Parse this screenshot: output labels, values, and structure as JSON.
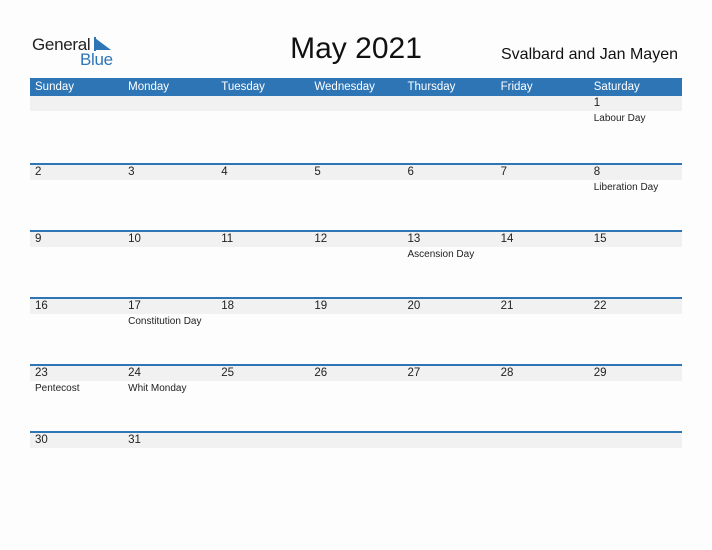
{
  "logo": {
    "general": "General",
    "blue": "Blue"
  },
  "title": "May 2021",
  "region": "Svalbard and Jan Mayen",
  "colors": {
    "accent": "#2e75b6",
    "strip": "#f1f1f1"
  },
  "weekdays": [
    "Sunday",
    "Monday",
    "Tuesday",
    "Wednesday",
    "Thursday",
    "Friday",
    "Saturday"
  ],
  "weeks": [
    [
      {
        "day": "",
        "holiday": ""
      },
      {
        "day": "",
        "holiday": ""
      },
      {
        "day": "",
        "holiday": ""
      },
      {
        "day": "",
        "holiday": ""
      },
      {
        "day": "",
        "holiday": ""
      },
      {
        "day": "",
        "holiday": ""
      },
      {
        "day": "1",
        "holiday": "Labour Day"
      }
    ],
    [
      {
        "day": "2",
        "holiday": ""
      },
      {
        "day": "3",
        "holiday": ""
      },
      {
        "day": "4",
        "holiday": ""
      },
      {
        "day": "5",
        "holiday": ""
      },
      {
        "day": "6",
        "holiday": ""
      },
      {
        "day": "7",
        "holiday": ""
      },
      {
        "day": "8",
        "holiday": "Liberation Day"
      }
    ],
    [
      {
        "day": "9",
        "holiday": ""
      },
      {
        "day": "10",
        "holiday": ""
      },
      {
        "day": "11",
        "holiday": ""
      },
      {
        "day": "12",
        "holiday": ""
      },
      {
        "day": "13",
        "holiday": "Ascension Day"
      },
      {
        "day": "14",
        "holiday": ""
      },
      {
        "day": "15",
        "holiday": ""
      }
    ],
    [
      {
        "day": "16",
        "holiday": ""
      },
      {
        "day": "17",
        "holiday": "Constitution Day"
      },
      {
        "day": "18",
        "holiday": ""
      },
      {
        "day": "19",
        "holiday": ""
      },
      {
        "day": "20",
        "holiday": ""
      },
      {
        "day": "21",
        "holiday": ""
      },
      {
        "day": "22",
        "holiday": ""
      }
    ],
    [
      {
        "day": "23",
        "holiday": "Pentecost"
      },
      {
        "day": "24",
        "holiday": "Whit Monday"
      },
      {
        "day": "25",
        "holiday": ""
      },
      {
        "day": "26",
        "holiday": ""
      },
      {
        "day": "27",
        "holiday": ""
      },
      {
        "day": "28",
        "holiday": ""
      },
      {
        "day": "29",
        "holiday": ""
      }
    ],
    [
      {
        "day": "30",
        "holiday": ""
      },
      {
        "day": "31",
        "holiday": ""
      },
      {
        "day": "",
        "holiday": ""
      },
      {
        "day": "",
        "holiday": ""
      },
      {
        "day": "",
        "holiday": ""
      },
      {
        "day": "",
        "holiday": ""
      },
      {
        "day": "",
        "holiday": ""
      }
    ]
  ]
}
